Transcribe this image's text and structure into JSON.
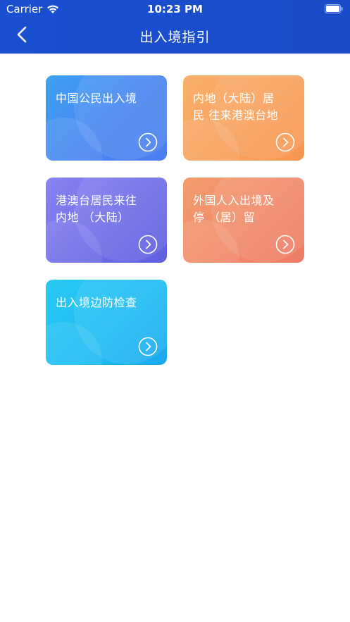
{
  "status_bar": {
    "carrier": "Carrier",
    "time": "10:23 PM"
  },
  "nav": {
    "title": "出入境指引",
    "back_icon": "chevron-left-icon"
  },
  "cards": [
    {
      "label": "中国公民出入境",
      "icon": "chevron-right-circle-icon",
      "color": "#4a86f0"
    },
    {
      "label": "内地（大陆）居民 往来港澳台地",
      "icon": "chevron-right-circle-icon",
      "color": "#f89f5c"
    },
    {
      "label": "港澳台居民来往内地 （大陆）",
      "icon": "chevron-right-circle-icon",
      "color": "#6e6de6"
    },
    {
      "label": "外国人入出境及停 （居）留",
      "icon": "chevron-right-circle-icon",
      "color": "#f1896b"
    },
    {
      "label": "出入境边防检查",
      "icon": "chevron-right-circle-icon",
      "color": "#1fbdf3"
    }
  ],
  "colors": {
    "header": "#1a4fd1",
    "background": "#ffffff"
  }
}
